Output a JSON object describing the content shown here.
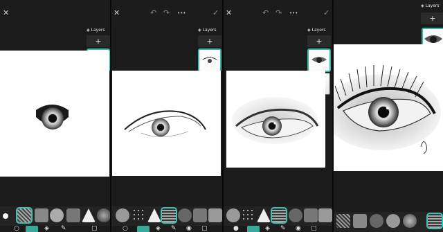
{
  "app": {
    "layers_title": "Layers",
    "add_layer_symbol": "+",
    "icons": {
      "close": "✕",
      "undo": "↶",
      "redo": "↷",
      "more": "•••",
      "confirm": "✓"
    },
    "accent_color": "#3fc2ad"
  },
  "panels": [
    {
      "step": 1,
      "drawing": "iris and upper lid shading"
    },
    {
      "step": 2,
      "drawing": "eye with eyelid line sketch"
    },
    {
      "step": 3,
      "drawing": "shaded eye with eyelid"
    },
    {
      "step": 4,
      "drawing": "detailed eye with lashes"
    }
  ],
  "brushes": [
    "round-brush",
    "charcoal-brush",
    "blend-brush",
    "texture-brush",
    "sponge-brush",
    "spray-brush",
    "ink-brush",
    "soft-brush"
  ],
  "tools": [
    "color-swatch",
    "brush-tool",
    "eraser-tool",
    "smudge-tool",
    "fill-tool",
    "select-tool",
    "layers-tool"
  ]
}
